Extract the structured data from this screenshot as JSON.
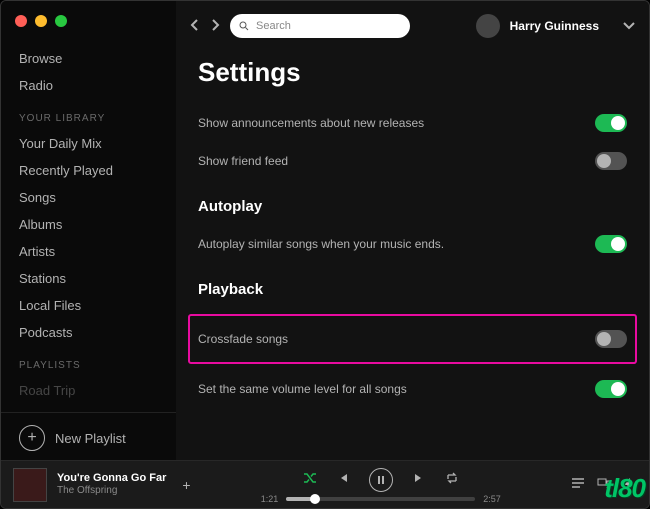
{
  "search": {
    "placeholder": "Search"
  },
  "user": {
    "name": "Harry Guinness"
  },
  "sidebar": {
    "main": [
      "Browse",
      "Radio"
    ],
    "library_header": "YOUR LIBRARY",
    "library": [
      "Your Daily Mix",
      "Recently Played",
      "Songs",
      "Albums",
      "Artists",
      "Stations",
      "Local Files",
      "Podcasts"
    ],
    "playlists_header": "PLAYLISTS",
    "playlists": [
      "Road Trip"
    ],
    "new_playlist": "New Playlist"
  },
  "settings": {
    "title": "Settings",
    "rows": {
      "announcements": {
        "label": "Show announcements about new releases",
        "on": true
      },
      "friend_feed": {
        "label": "Show friend feed",
        "on": false
      },
      "autoplay_header": "Autoplay",
      "autoplay_similar": {
        "label": "Autoplay similar songs when your music ends.",
        "on": true
      },
      "playback_header": "Playback",
      "crossfade": {
        "label": "Crossfade songs",
        "on": false
      },
      "normalize": {
        "label": "Set the same volume level for all songs",
        "on": true
      }
    }
  },
  "player": {
    "title": "You're Gonna Go Far",
    "artist": "The Offspring",
    "elapsed": "1:21",
    "total": "2:57",
    "progress_pct": 15
  },
  "watermark": "tl80"
}
